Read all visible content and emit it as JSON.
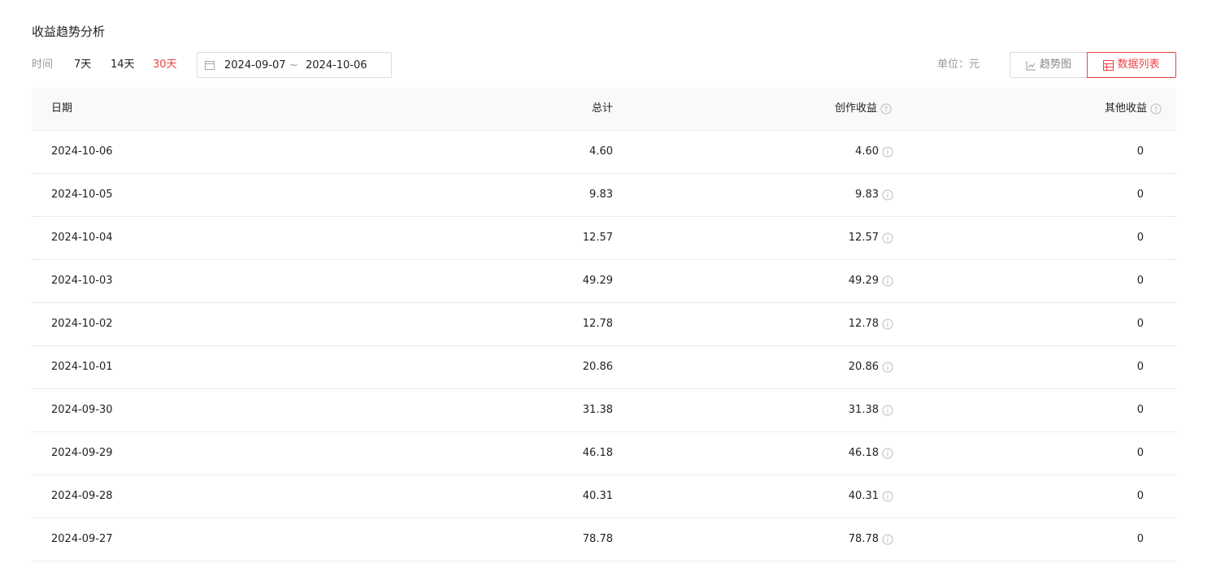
{
  "page": {
    "title": "收益趋势分析"
  },
  "filters": {
    "time_label": "时间",
    "ranges": [
      {
        "label": "7天",
        "active": false
      },
      {
        "label": "14天",
        "active": false
      },
      {
        "label": "30天",
        "active": true
      }
    ],
    "date_range": {
      "start": "2024-09-07",
      "separator": "~",
      "end": "2024-10-06",
      "icon": "calendar-icon"
    },
    "unit_label": "单位：元",
    "views": [
      {
        "label": "趋势图",
        "icon": "line-chart-icon",
        "active": false
      },
      {
        "label": "数据列表",
        "icon": "table-icon",
        "active": true
      }
    ]
  },
  "table": {
    "headers": {
      "date": "日期",
      "total": "总计",
      "creation": "创作收益",
      "other": "其他收益"
    },
    "rows": [
      {
        "date": "2024-10-06",
        "total": "4.60",
        "creation": "4.60",
        "other": "0"
      },
      {
        "date": "2024-10-05",
        "total": "9.83",
        "creation": "9.83",
        "other": "0"
      },
      {
        "date": "2024-10-04",
        "total": "12.57",
        "creation": "12.57",
        "other": "0"
      },
      {
        "date": "2024-10-03",
        "total": "49.29",
        "creation": "49.29",
        "other": "0"
      },
      {
        "date": "2024-10-02",
        "total": "12.78",
        "creation": "12.78",
        "other": "0"
      },
      {
        "date": "2024-10-01",
        "total": "20.86",
        "creation": "20.86",
        "other": "0"
      },
      {
        "date": "2024-09-30",
        "total": "31.38",
        "creation": "31.38",
        "other": "0"
      },
      {
        "date": "2024-09-29",
        "total": "46.18",
        "creation": "46.18",
        "other": "0"
      },
      {
        "date": "2024-09-28",
        "total": "40.31",
        "creation": "40.31",
        "other": "0"
      },
      {
        "date": "2024-09-27",
        "total": "78.78",
        "creation": "78.78",
        "other": "0"
      }
    ]
  },
  "colors": {
    "accent": "#f04142",
    "muted": "#999999",
    "border": "#ececec",
    "header_bg": "#f9f9f9"
  }
}
